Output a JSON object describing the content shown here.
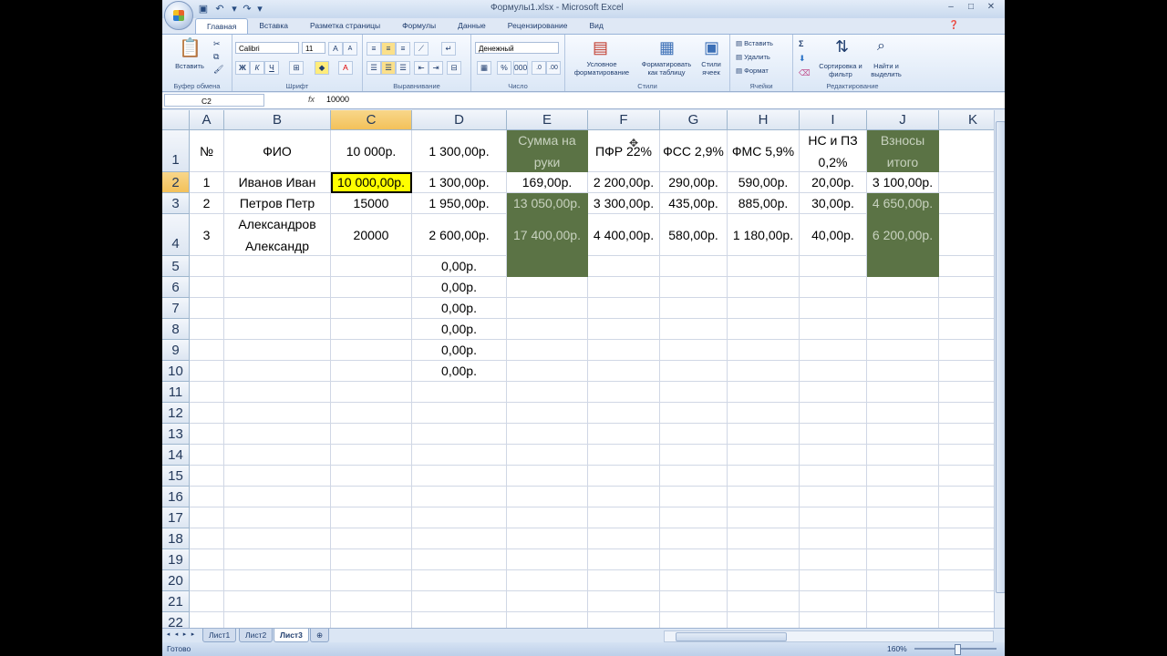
{
  "window": {
    "title": "Формулы1.xlsx - Microsoft Excel"
  },
  "ribbon": {
    "tabs": [
      "Главная",
      "Вставка",
      "Разметка страницы",
      "Формулы",
      "Данные",
      "Рецензирование",
      "Вид"
    ],
    "active_tab": "Главная",
    "clipboard": {
      "paste_label": "Вставить",
      "group_label": "Буфер обмена"
    },
    "font": {
      "name": "Calibri",
      "size": "11",
      "group_label": "Шрифт",
      "bold": "Ж",
      "italic": "К",
      "underline": "Ч"
    },
    "alignment": {
      "group_label": "Выравнивание"
    },
    "number": {
      "format": "Денежный",
      "group_label": "Число"
    },
    "styles": {
      "conditional": "Условное форматирование",
      "as_table": "Форматировать как таблицу",
      "cell_styles": "Стили ячеек",
      "group_label": "Стили"
    },
    "cells": {
      "insert": "Вставить",
      "delete": "Удалить",
      "format": "Формат",
      "group_label": "Ячейки"
    },
    "editing": {
      "sort": "Сортировка и фильтр",
      "find": "Найти и выделить",
      "group_label": "Редактирование"
    }
  },
  "formula_bar": {
    "name_box": "C2",
    "fx": "fx",
    "value": "10000"
  },
  "grid": {
    "columns": [
      "A",
      "B",
      "C",
      "D",
      "E",
      "F",
      "G",
      "H",
      "I",
      "J",
      "K"
    ],
    "row_numbers": [
      "1",
      "2",
      "3",
      "4",
      "5",
      "6",
      "7",
      "8",
      "9",
      "10",
      "11",
      "12",
      "13",
      "14",
      "15",
      "16",
      "17",
      "18",
      "19",
      "20",
      "21",
      "22"
    ],
    "rows": [
      [
        "№",
        "ФИО",
        "10 000р.",
        "1 300,00р.",
        "Сумма на руки",
        "ПФР 22%",
        "ФСС 2,9%",
        "ФМС 5,9%",
        "НС и ПЗ 0,2%",
        "Взносы итого",
        ""
      ],
      [
        "1",
        "Иванов Иван",
        "10 000,00р.",
        "1 300,00р.",
        "169,00р.",
        "2 200,00р.",
        "290,00р.",
        "590,00р.",
        "20,00р.",
        "3 100,00р.",
        ""
      ],
      [
        "2",
        "Петров Петр",
        "15000",
        "1 950,00р.",
        "13 050,00р.",
        "3 300,00р.",
        "435,00р.",
        "885,00р.",
        "30,00р.",
        "4 650,00р.",
        ""
      ],
      [
        "3",
        "Александров Александр",
        "20000",
        "2 600,00р.",
        "17 400,00р.",
        "4 400,00р.",
        "580,00р.",
        "1 180,00р.",
        "40,00р.",
        "6 200,00р.",
        ""
      ],
      [
        "",
        "",
        "",
        "0,00р.",
        "",
        "",
        "",
        "",
        "",
        "",
        ""
      ],
      [
        "",
        "",
        "",
        "0,00р.",
        "",
        "",
        "",
        "",
        "",
        "",
        ""
      ],
      [
        "",
        "",
        "",
        "0,00р.",
        "",
        "",
        "",
        "",
        "",
        "",
        ""
      ],
      [
        "",
        "",
        "",
        "0,00р.",
        "",
        "",
        "",
        "",
        "",
        "",
        ""
      ],
      [
        "",
        "",
        "",
        "0,00р.",
        "",
        "",
        "",
        "",
        "",
        "",
        ""
      ],
      [
        "",
        "",
        "",
        "0,00р.",
        "",
        "",
        "",
        "",
        "",
        "",
        ""
      ]
    ],
    "selected_cell": "C2"
  },
  "sheets": {
    "tabs": [
      "Лист1",
      "Лист2",
      "Лист3"
    ],
    "active": "Лист3"
  },
  "status": {
    "text": "Готово",
    "zoom": "160%"
  },
  "colors": {
    "green_fill": "#5b7345",
    "yellow_fill": "#ffff00",
    "selection_header": "#f3c15a"
  }
}
